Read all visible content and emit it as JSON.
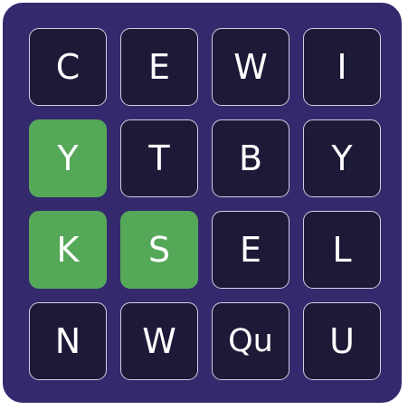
{
  "colors": {
    "board_background": "#35296e",
    "board_border": "#ffffff",
    "tile_background": "#1c1a37",
    "tile_selected": "#55a858",
    "letter_color": "#ffffff"
  },
  "board": {
    "rows": [
      [
        {
          "letter": "C",
          "selected": false
        },
        {
          "letter": "E",
          "selected": false
        },
        {
          "letter": "W",
          "selected": false
        },
        {
          "letter": "I",
          "selected": false
        }
      ],
      [
        {
          "letter": "Y",
          "selected": true
        },
        {
          "letter": "T",
          "selected": false
        },
        {
          "letter": "B",
          "selected": false
        },
        {
          "letter": "Y",
          "selected": false
        }
      ],
      [
        {
          "letter": "K",
          "selected": true
        },
        {
          "letter": "S",
          "selected": true
        },
        {
          "letter": "E",
          "selected": false
        },
        {
          "letter": "L",
          "selected": false
        }
      ],
      [
        {
          "letter": "N",
          "selected": false
        },
        {
          "letter": "W",
          "selected": false
        },
        {
          "letter": "Qu",
          "selected": false
        },
        {
          "letter": "U",
          "selected": false
        }
      ]
    ]
  }
}
